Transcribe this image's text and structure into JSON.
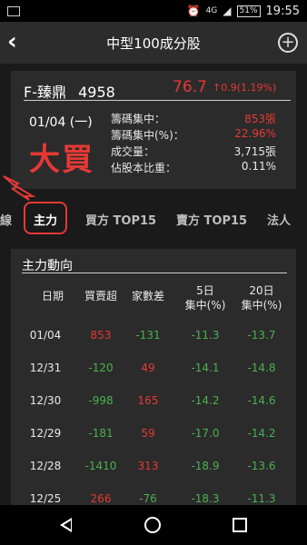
{
  "status_bar": {
    "signal_label": "4G",
    "battery": "51%",
    "time": "19:55"
  },
  "header": {
    "title": "中型100成分股",
    "back_icon": "back-icon",
    "add_icon": "plus-circle-icon"
  },
  "stock": {
    "name": "F-臻鼎",
    "code": "4958",
    "price": "76.7",
    "change": "↑0.9(1.19%)",
    "date": "01/04 (一)",
    "signal": "大買",
    "stats": [
      {
        "label": "籌碼集中：",
        "value": "853張",
        "color": "red"
      },
      {
        "label": "籌碼集中(%)：",
        "value": "22.96%",
        "color": "red"
      },
      {
        "label": "成交量：",
        "value": "3,715張",
        "color": "white"
      },
      {
        "label": "佔股本比重：",
        "value": "0.11%",
        "color": "white"
      }
    ]
  },
  "tabs": {
    "prev_partial": "線",
    "main": "主力",
    "buy_top": "買方 TOP15",
    "sell_top": "賣方 TOP15",
    "institution": "法人"
  },
  "panel": {
    "title": "主力動向",
    "headers": {
      "date": "日期",
      "net": "買賣超",
      "brokers": "家數差",
      "d5_line1": "5日",
      "d5_line2": "集中(%)",
      "d20_line1": "20日",
      "d20_line2": "集中(%)"
    },
    "rows": [
      {
        "date": "01/04",
        "net": "853",
        "brokers": "-131",
        "d5": "-11.3",
        "d20": "-13.7"
      },
      {
        "date": "12/31",
        "net": "-120",
        "brokers": "49",
        "d5": "-14.1",
        "d20": "-14.8"
      },
      {
        "date": "12/30",
        "net": "-998",
        "brokers": "165",
        "d5": "-14.2",
        "d20": "-14.6"
      },
      {
        "date": "12/29",
        "net": "-181",
        "brokers": "59",
        "d5": "-17.0",
        "d20": "-14.2"
      },
      {
        "date": "12/28",
        "net": "-1410",
        "brokers": "313",
        "d5": "-18.9",
        "d20": "-13.6"
      },
      {
        "date": "12/25",
        "net": "266",
        "brokers": "-76",
        "d5": "-18.3",
        "d20": "-11.3"
      }
    ]
  },
  "colors": {
    "up": "#e53935",
    "down": "#4caf50",
    "background": "#1a1a1a",
    "card": "#2b2b2b"
  }
}
